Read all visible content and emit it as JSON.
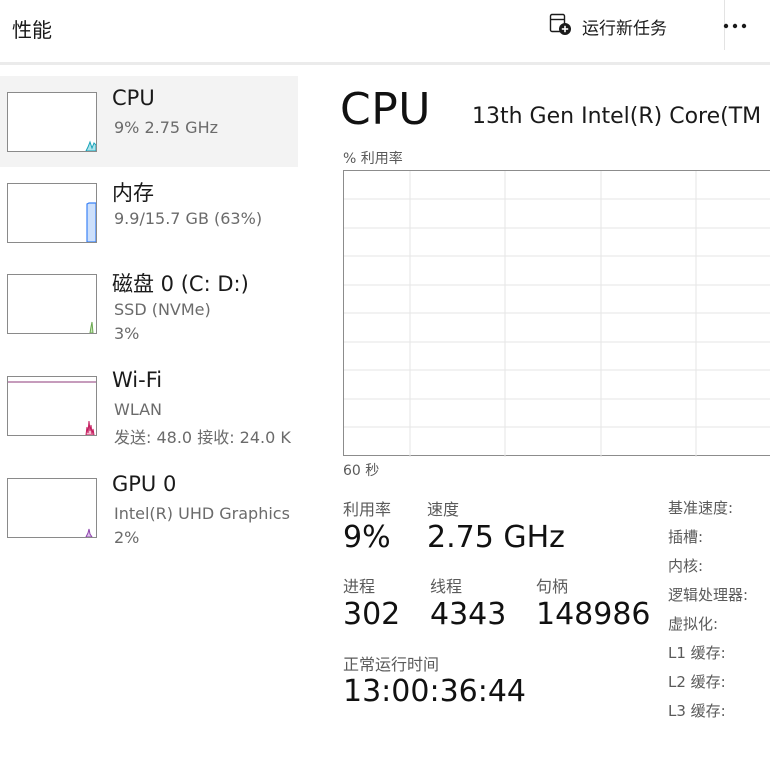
{
  "header": {
    "title": "性能",
    "run_task_label": "运行新任务",
    "more_label": "•••"
  },
  "sidebar": {
    "items": [
      {
        "title": "CPU",
        "subtitle": "9%  2.75 GHz",
        "subtitle2": "",
        "graph_color": "#17a2b8"
      },
      {
        "title": "内存",
        "subtitle": "9.9/15.7 GB (63%)",
        "subtitle2": "",
        "graph_color": "#3b82f6"
      },
      {
        "title": "磁盘 0 (C: D:)",
        "subtitle": "SSD (NVMe)",
        "subtitle2": "3%",
        "graph_color": "#6aa84f"
      },
      {
        "title": "Wi-Fi",
        "subtitle": "WLAN",
        "subtitle2": "发送: 48.0  接收: 24.0 K",
        "graph_color": "#c2185b"
      },
      {
        "title": "GPU 0",
        "subtitle": "Intel(R) UHD Graphics",
        "subtitle2": "2%",
        "graph_color": "#8e44ad"
      }
    ]
  },
  "main": {
    "title": "CPU",
    "processor": "13th Gen Intel(R) Core(TM",
    "util_label": "% 利用率",
    "time_label": "60 秒",
    "stats": {
      "utilization_label": "利用率",
      "utilization": "9%",
      "speed_label": "速度",
      "speed": "2.75 GHz",
      "processes_label": "进程",
      "processes": "302",
      "threads_label": "线程",
      "threads": "4343",
      "handles_label": "句柄",
      "handles": "148986",
      "uptime_label": "正常运行时间",
      "uptime": "13:00:36:44"
    },
    "specs": [
      "基准速度:",
      "插槽:",
      "内核:",
      "逻辑处理器:",
      "虚拟化:",
      "L1 缓存:",
      "L2 缓存:",
      "L3 缓存:"
    ]
  },
  "colors": {
    "accent_cpu": "#17a2b8",
    "graph_grid": "#e6e6e6",
    "graph_border": "#8c8c8c",
    "selected_bg": "#f3f3f3"
  }
}
